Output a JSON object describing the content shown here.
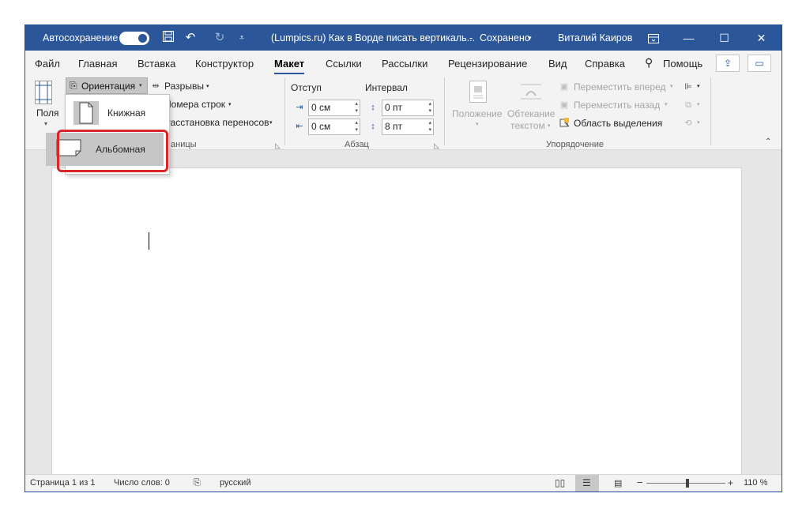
{
  "titlebar": {
    "autosave_label": "Автосохранение",
    "doc_title": "(Lumpics.ru) Как в Ворде писать вертикаль...",
    "separator": "-",
    "save_status": "Сохранено",
    "save_status_chevron": "▾",
    "user_name": "Виталий Каиров",
    "icons": [
      "save-icon",
      "undo-icon",
      "redo-icon",
      "customize-qat-icon",
      "ribbon-display-icon",
      "minimize-icon",
      "maximize-icon",
      "close-icon"
    ]
  },
  "menu": {
    "tabs": [
      "Файл",
      "Главная",
      "Вставка",
      "Конструктор",
      "Макет",
      "Ссылки",
      "Рассылки",
      "Рецензирование",
      "Вид",
      "Справка"
    ],
    "active_tab": "Макет",
    "search_label": "Помощь"
  },
  "ribbon": {
    "page_setup": {
      "margins_label": "Поля",
      "orientation_label": "Ориентация",
      "breaks_label": "Разрывы",
      "line_numbers_label": "Номера строк",
      "hyphenation_label": "Расстановка переносов",
      "group_label_partial": "аницы"
    },
    "paragraph": {
      "indent_label": "Отступ",
      "spacing_label": "Интервал",
      "indent_left": "0 см",
      "indent_right": "0 см",
      "spacing_before": "0 пт",
      "spacing_after": "8 пт",
      "group_label": "Абзац"
    },
    "arrange": {
      "position_label": "Положение",
      "wrap_label_1": "Обтекание",
      "wrap_label_2": "текстом",
      "bring_forward": "Переместить вперед",
      "send_backward": "Переместить назад",
      "selection_pane": "Область выделения",
      "group_label": "Упорядочение"
    }
  },
  "orientation_menu": {
    "portrait_label": "Книжная",
    "landscape_label": "Альбомная",
    "selected": "Альбомная"
  },
  "statusbar": {
    "page_info": "Страница 1 из 1",
    "word_count": "Число слов: 0",
    "language": "русский",
    "zoom_minus": "−",
    "zoom_plus": "+",
    "zoom_level": "110 %"
  },
  "colors": {
    "title_bar": "#2b579a",
    "highlight_border": "#d9262b"
  }
}
